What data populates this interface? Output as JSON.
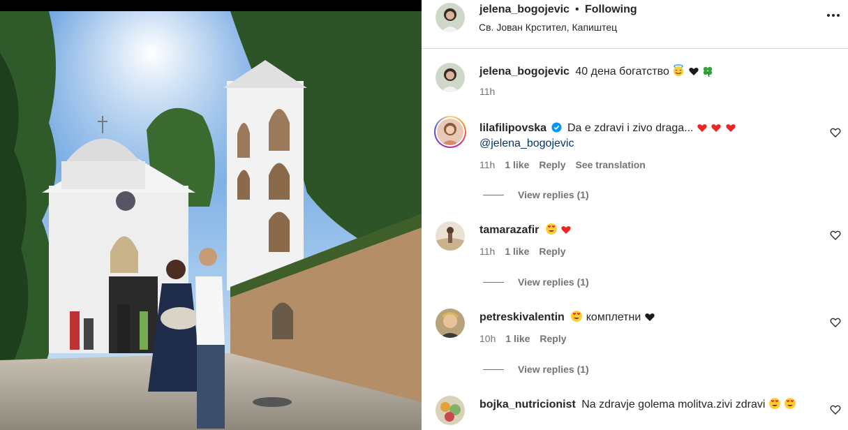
{
  "post": {
    "author": "jelena_bogojevic",
    "separator": "•",
    "follow_status": "Following",
    "location": "Св. Јован Крстител, Капиштец"
  },
  "caption": {
    "user": "jelena_bogojevic",
    "text": "40 дена богатство",
    "time": "11h"
  },
  "comments": [
    {
      "user": "lilafilipovska",
      "verified": true,
      "text": "Da e zdravi i zivo draga...",
      "mention": "@jelena_bogojevic",
      "time": "11h",
      "likes": "1 like",
      "reply": "Reply",
      "translate": "See translation",
      "view_replies": "View replies (1)"
    },
    {
      "user": "tamarazafir",
      "text": "",
      "time": "11h",
      "likes": "1 like",
      "reply": "Reply",
      "view_replies": "View replies (1)"
    },
    {
      "user": "petreskivalentin",
      "text": "комплетни",
      "time": "10h",
      "likes": "1 like",
      "reply": "Reply",
      "view_replies": "View replies (1)"
    },
    {
      "user": "bojka_nutricionist",
      "text": "Na zdravje golema molitva.zivi zdravi"
    }
  ],
  "colors": {
    "text": "#262626",
    "secondary": "#737373",
    "link": "#00376b",
    "verified": "#0095f6",
    "heart_red": "#ed2424",
    "divider": "#dbdbdb"
  },
  "icons": [
    "more-options-icon",
    "like-heart-icon",
    "verified-badge-icon",
    "red-heart-emoji",
    "black-heart-emoji",
    "heart-eyes-emoji",
    "smiling-face-with-halo-emoji",
    "four-leaf-clover-emoji"
  ]
}
